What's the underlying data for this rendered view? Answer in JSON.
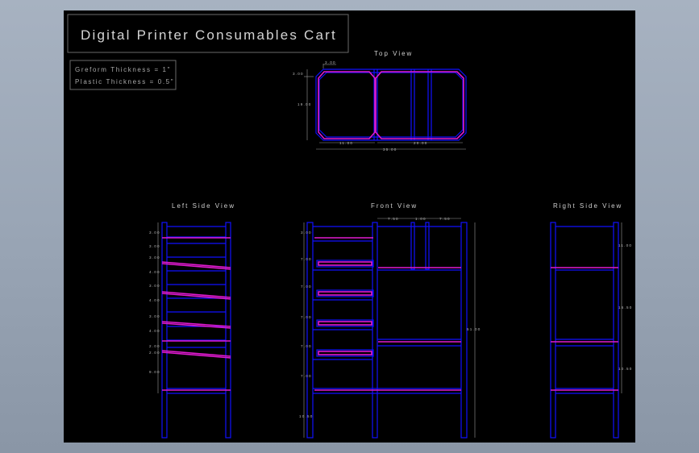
{
  "title": "Digital Printer Consumables Cart",
  "notes": [
    "Greform Thickness = 1\"",
    "Plastic Thickness = 0.5\""
  ],
  "views": {
    "top": {
      "label": "Top View",
      "dims": [
        "3.00",
        "3.00",
        "19.00",
        "11.00",
        "20.00",
        "35.00"
      ]
    },
    "left": {
      "label": "Left Side View",
      "dims": [
        "3.00",
        "3.00",
        "3.00",
        "4.00",
        "3.00",
        "4.00",
        "3.00",
        "4.00",
        "2.00",
        "2.00",
        "9.00"
      ]
    },
    "front": {
      "label": "Front View",
      "dims": [
        "3.00",
        "7.00",
        "7.00",
        "7.00",
        "7.00",
        "7.00",
        "10.50",
        "7.50",
        "1.00",
        "7.50",
        "51.00"
      ]
    },
    "right": {
      "label": "Right Side View",
      "dims": [
        "11.00",
        "16.50",
        "10.50"
      ]
    }
  },
  "colors": {
    "frame": "#1010ff",
    "plastic": "#e01ad0",
    "sheet": "#000000"
  }
}
